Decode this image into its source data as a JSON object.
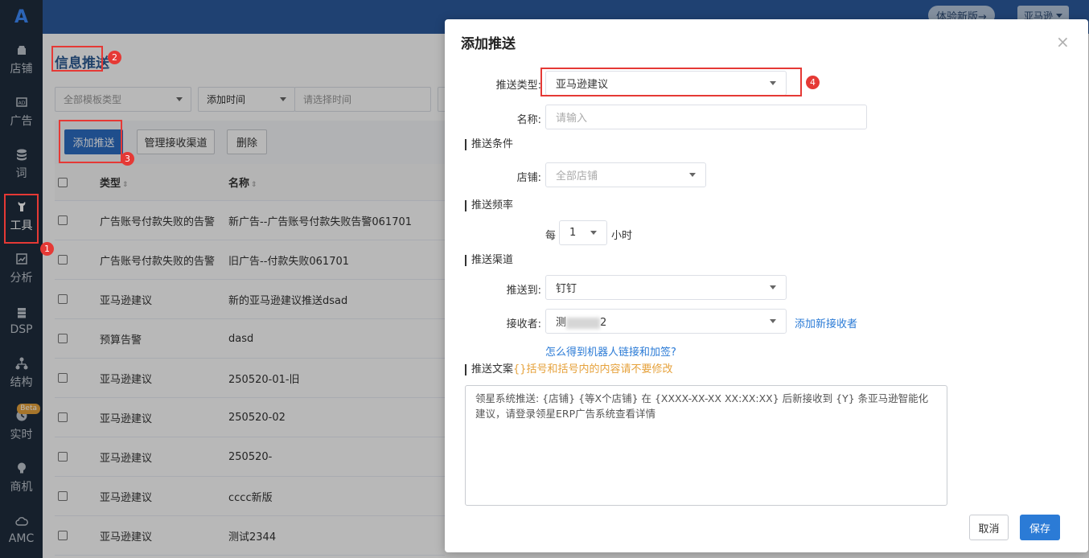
{
  "sidebar": {
    "logo": "A",
    "items": [
      {
        "label": "店铺",
        "icon": "store-icon"
      },
      {
        "label": "广告",
        "icon": "ad-icon"
      },
      {
        "label": "词",
        "icon": "database-icon"
      },
      {
        "label": "工具",
        "icon": "wrench-icon"
      },
      {
        "label": "分析",
        "icon": "chart-icon"
      },
      {
        "label": "DSP",
        "icon": "server-icon"
      },
      {
        "label": "结构",
        "icon": "tree-icon"
      },
      {
        "label": "实时",
        "icon": "clock-icon"
      },
      {
        "label": "商机",
        "icon": "bulb-icon"
      },
      {
        "label": "AMC",
        "icon": "cloud-icon"
      }
    ],
    "beta_badge": "Beta"
  },
  "topbar": {
    "new_version_label": "体验新版→",
    "user_label": "亚马逊"
  },
  "page": {
    "title": "信息推送",
    "filters": {
      "template_type": "全部模板类型",
      "time_field": "添加时间",
      "time_placeholder": "请选择时间"
    },
    "toolbar": {
      "add_label": "添加推送",
      "manage_label": "管理接收渠道",
      "delete_label": "删除"
    },
    "table": {
      "headers": {
        "type": "类型",
        "name": "名称"
      },
      "rows": [
        {
          "type": "广告账号付款失败的告警",
          "name": "新广告--广告账号付款失败告警061701"
        },
        {
          "type": "广告账号付款失败的告警",
          "name": "旧广告--付款失败061701"
        },
        {
          "type": "亚马逊建议",
          "name": "新的亚马逊建议推送dsad"
        },
        {
          "type": "预算告警",
          "name": "dasd"
        },
        {
          "type": "亚马逊建议",
          "name": "250520-01-旧"
        },
        {
          "type": "亚马逊建议",
          "name": "250520-02"
        },
        {
          "type": "亚马逊建议",
          "name": "250520-"
        },
        {
          "type": "亚马逊建议",
          "name": "cccc新版"
        },
        {
          "type": "亚马逊建议",
          "name": "测试2344"
        }
      ]
    }
  },
  "markers": [
    "1",
    "2",
    "3",
    "4"
  ],
  "modal": {
    "title": "添加推送",
    "close": "×",
    "push_type_label": "推送类型:",
    "push_type_value": "亚马逊建议",
    "name_label": "名称:",
    "name_placeholder": "请输入",
    "section_condition": "推送条件",
    "store_label": "店铺:",
    "store_value": "全部店铺",
    "section_frequency": "推送频率",
    "freq_prefix": "每",
    "freq_value": "1",
    "freq_suffix": "小时",
    "section_channel": "推送渠道",
    "push_to_label": "推送到:",
    "push_to_value": "钉钉",
    "receiver_label": "接收者:",
    "receiver_value_start": "测",
    "receiver_value_end": "2",
    "add_receiver": "添加新接收者",
    "robot_help": "怎么得到机器人链接和加签?",
    "section_copy": "推送文案",
    "copy_hint": "{}括号和括号内的内容请不要修改",
    "copy_text": "领星系统推送: {店铺} {等X个店铺} 在 {XXXX-XX-XX XX:XX:XX} 后新接收到 {Y} 条亚马逊智能化建议，请登录领星ERP广告系统查看详情",
    "cancel_label": "取消",
    "save_label": "保存"
  }
}
